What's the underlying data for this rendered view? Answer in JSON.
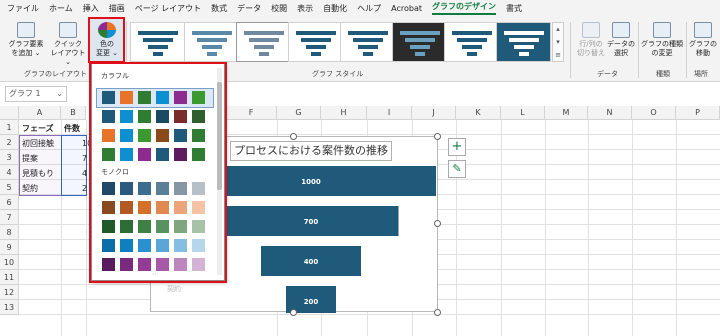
{
  "tabs": [
    "ファイル",
    "ホーム",
    "挿入",
    "描画",
    "ページ レイアウト",
    "数式",
    "データ",
    "校閲",
    "表示",
    "自動化",
    "ヘルプ",
    "Acrobat",
    "グラフのデザイン",
    "書式"
  ],
  "active_tab": "グラフのデザイン",
  "ribbon": {
    "add_element": {
      "line1": "グラフ要素",
      "line2": "を追加 ⌄"
    },
    "quick_layout": {
      "line1": "クイック",
      "line2": "レイアウト ⌄"
    },
    "change_colors": {
      "line1": "色の",
      "line2": "変更 ⌄"
    },
    "group_layout": "グラフのレイアウト",
    "group_style": "グラフ スタイル",
    "switch_row_col": {
      "line1": "行/列の",
      "line2": "切り替え"
    },
    "select_data": {
      "line1": "データの",
      "line2": "選択"
    },
    "group_data": "データ",
    "change_type": {
      "line1": "グラフの種類",
      "line2": "の変更"
    },
    "group_type": "種類",
    "move_chart": {
      "line1": "グラフの",
      "line2": "移動"
    },
    "group_location": "場所"
  },
  "name_box": "グラフ 1",
  "columns": [
    "A",
    "B",
    "F",
    "G",
    "H",
    "I",
    "J",
    "K",
    "L",
    "M",
    "N",
    "O",
    "P"
  ],
  "rows": [
    "1",
    "2",
    "3",
    "4",
    "5",
    "6",
    "7",
    "8",
    "9",
    "10",
    "11",
    "12",
    "13"
  ],
  "table": {
    "header": [
      "フェーズ",
      "件数"
    ],
    "rows": [
      [
        "初回接触",
        "1000"
      ],
      [
        "提案",
        "700"
      ],
      [
        "見積もり",
        "400"
      ],
      [
        "契約",
        "200"
      ]
    ],
    "visible_b": [
      "10",
      "7",
      "4",
      "2"
    ]
  },
  "chart": {
    "title": "各プロセスにおける案件数の推移",
    "title_visible": "プロセスにおける案件数の推移",
    "faint_axis_label": "契約",
    "bar_color": "#1f5a7a"
  },
  "chart_data": {
    "type": "bar",
    "categories": [
      "初回接触",
      "提案",
      "見積もり",
      "契約"
    ],
    "values": [
      1000,
      700,
      400,
      200
    ],
    "title": "各プロセスにおける案件数の推移"
  },
  "palette": {
    "colorful_label": "カラフル",
    "mono_label": "モノクロ",
    "colorful_rows": [
      [
        "#1f5a7a",
        "#e8742a",
        "#2e7d32",
        "#0e8fd0",
        "#8e2b8f",
        "#3a9a2f"
      ],
      [
        "#1f5a7a",
        "#0e8fd0",
        "#2e7d32",
        "#1b4b63",
        "#7a2b2b",
        "#2f5f2f"
      ],
      [
        "#e8742a",
        "#0e8fd0",
        "#3a9a2f",
        "#8b4a1a",
        "#1f5a7a",
        "#2e7d32"
      ],
      [
        "#2e7d32",
        "#0e8fd0",
        "#8e2b8f",
        "#1f5a7a",
        "#5e1a5e",
        "#2e7d32"
      ]
    ],
    "mono_rows": [
      [
        "#1f4a6a",
        "#2a5a7e",
        "#3d6d8e",
        "#5a7f96",
        "#8796a4",
        "#b5c0c8"
      ],
      [
        "#8a4a1f",
        "#b25a22",
        "#d4702a",
        "#e08a50",
        "#eca57a",
        "#f3c3a3"
      ],
      [
        "#1f5a2a",
        "#2e6e36",
        "#3f8045",
        "#5a9160",
        "#7fa67f",
        "#a8c2a7"
      ],
      [
        "#0c6ea8",
        "#0e7fc0",
        "#2a90cf",
        "#5aa6d8",
        "#86bde3",
        "#b6d6ee"
      ],
      [
        "#5a1a5e",
        "#7a2b7e",
        "#933b95",
        "#a85aa9",
        "#bd86be",
        "#d5b3d5"
      ]
    ]
  }
}
